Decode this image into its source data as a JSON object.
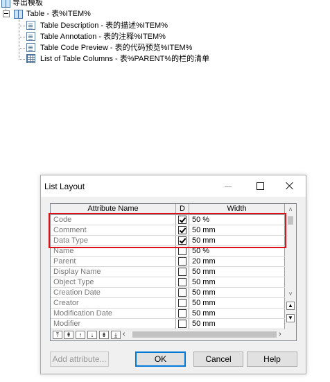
{
  "tree": {
    "root_label": "导出模板",
    "table_node_label": "Table - 表%ITEM%",
    "children": [
      {
        "label": "Table Description - 表的描述%ITEM%",
        "icon": "document-icon"
      },
      {
        "label": "Table Annotation - 表的注释%ITEM%",
        "icon": "document-icon"
      },
      {
        "label": "Table Code Preview - 表的代码预览%ITEM%",
        "icon": "document-icon"
      },
      {
        "label": "List of Table Columns - 表%PARENT%的栏的清单",
        "icon": "list-grid-icon"
      }
    ]
  },
  "dialog": {
    "title": "List Layout",
    "columns": {
      "name": "Attribute Name",
      "display": "D",
      "width": "Width"
    },
    "rows": [
      {
        "name": "Code",
        "checked": true,
        "width": "50 %"
      },
      {
        "name": "Comment",
        "checked": true,
        "width": "50 mm"
      },
      {
        "name": "Data Type",
        "checked": true,
        "width": "50 mm"
      },
      {
        "name": "Name",
        "checked": false,
        "width": "50 %"
      },
      {
        "name": "Parent",
        "checked": false,
        "width": "20 mm"
      },
      {
        "name": "Display Name",
        "checked": false,
        "width": "50 mm"
      },
      {
        "name": "Object Type",
        "checked": false,
        "width": "50 mm"
      },
      {
        "name": "Creation Date",
        "checked": false,
        "width": "50 mm"
      },
      {
        "name": "Creator",
        "checked": false,
        "width": "50 mm"
      },
      {
        "name": "Modification Date",
        "checked": false,
        "width": "50 mm"
      },
      {
        "name": "Modifier",
        "checked": false,
        "width": "50 mm"
      }
    ],
    "buttons": {
      "add": "Add attribute...",
      "ok": "OK",
      "cancel": "Cancel",
      "help": "Help"
    },
    "highlight_color": "#e0101a",
    "accent_color": "#0078d7"
  }
}
